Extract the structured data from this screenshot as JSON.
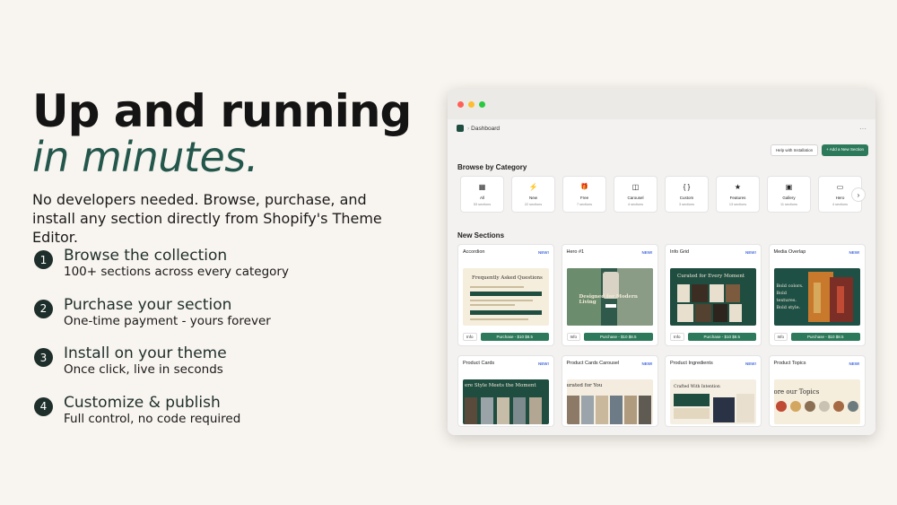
{
  "hero": {
    "title": "Up and running",
    "subtitle": "in minutes.",
    "description": "No developers needed. Browse, purchase, and install any section directly from Shopify's Theme Editor."
  },
  "steps": [
    {
      "num": "1",
      "title": "Browse the collection",
      "desc": "100+ sections across every category"
    },
    {
      "num": "2",
      "title": "Purchase your section",
      "desc": "One-time payment - yours forever"
    },
    {
      "num": "3",
      "title": "Install on your theme",
      "desc": "Once click, live in seconds"
    },
    {
      "num": "4",
      "title": "Customize & publish",
      "desc": "Full control, no code required"
    }
  ],
  "app": {
    "breadcrumb": "Dashboard",
    "help_button": "Help with Installation",
    "add_button": "+ Add a New Section",
    "browse_heading": "Browse by Category",
    "new_heading": "New Sections",
    "categories": [
      {
        "icon": "grid-icon",
        "glyph": "▦",
        "name": "All",
        "count": "53 sections"
      },
      {
        "icon": "lightning-icon",
        "glyph": "⚡",
        "name": "New",
        "count": "22 sections"
      },
      {
        "icon": "gift-icon",
        "glyph": "🎁",
        "name": "Free",
        "count": "7 sections"
      },
      {
        "icon": "carousel-icon",
        "glyph": "◫",
        "name": "Carousel",
        "count": "4 sections"
      },
      {
        "icon": "code-icon",
        "glyph": "{ }",
        "name": "Custom",
        "count": "3 sections"
      },
      {
        "icon": "star-icon",
        "glyph": "★",
        "name": "Features",
        "count": "13 sections"
      },
      {
        "icon": "image-icon",
        "glyph": "▣",
        "name": "Gallery",
        "count": "11 sections"
      },
      {
        "icon": "hero-icon",
        "glyph": "▭",
        "name": "Hero",
        "count": "4 sections"
      }
    ],
    "cards": [
      {
        "name": "Accordion",
        "badge": "NEW!",
        "thumb_title": "Frequently Asked Questions",
        "info": "Info",
        "buy": "Purchase - $10 $8.5"
      },
      {
        "name": "Hero #1",
        "badge": "NEW!",
        "thumb_title": "Designed for Modern Living",
        "info": "Info",
        "buy": "Purchase - $10 $8.5"
      },
      {
        "name": "Info Grid",
        "badge": "NEW!",
        "thumb_title": "Curated for Every Moment",
        "info": "Info",
        "buy": "Purchase - $10 $8.5"
      },
      {
        "name": "Media Overlap",
        "badge": "NEW!",
        "thumb_title": "Bold colors. Bold textures. Bold style.",
        "info": "Info",
        "buy": "Purchase - $10 $8.5"
      },
      {
        "name": "Product Cards",
        "badge": "NEW!",
        "thumb_title": "ere Style Meets the Moment"
      },
      {
        "name": "Product Cards Carousel",
        "badge": "NEW!",
        "thumb_title": "urated for You"
      },
      {
        "name": "Product Ingredients",
        "badge": "NEW!",
        "thumb_title": "Crafted With Intention"
      },
      {
        "name": "Product Topics",
        "badge": "NEW!",
        "thumb_title": "ore our Topics"
      }
    ]
  }
}
